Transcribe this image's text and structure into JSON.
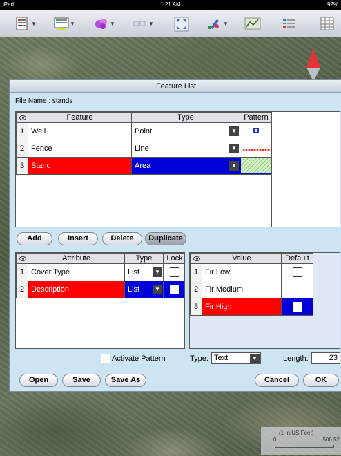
{
  "status": {
    "device": "iPad",
    "time": "1:21 AM",
    "battery": "92%"
  },
  "toolbar": {
    "buttons": [
      {
        "name": "layers-icon",
        "dropdown": true
      },
      {
        "name": "feature-icon",
        "dropdown": true
      },
      {
        "name": "shapes-icon",
        "dropdown": true
      },
      {
        "name": "gps-icon",
        "dropdown": true
      },
      {
        "name": "zoom-extent-icon",
        "dropdown": false
      },
      {
        "name": "edit-tools-icon",
        "dropdown": true
      },
      {
        "name": "measure-icon",
        "dropdown": false
      },
      {
        "name": "legend-icon",
        "dropdown": false
      },
      {
        "name": "table-icon",
        "dropdown": false
      }
    ]
  },
  "dialog": {
    "title": "Feature List",
    "file_label": "File Name : stands",
    "feature_table": {
      "headers": {
        "feature": "Feature",
        "type": "Type",
        "pattern": "Pattern"
      },
      "rows": [
        {
          "num": "1",
          "feature": "Well",
          "type": "Point",
          "pattern": "point",
          "selected": false
        },
        {
          "num": "2",
          "feature": "Fence",
          "type": "Line",
          "pattern": "line",
          "selected": false
        },
        {
          "num": "3",
          "feature": "Stand",
          "type": "Area",
          "pattern": "area",
          "selected": true
        }
      ]
    },
    "buttons": {
      "add": "Add",
      "insert": "Insert",
      "delete": "Delete",
      "duplicate": "Duplicate"
    },
    "attribute_table": {
      "headers": {
        "attribute": "Attribute",
        "type": "Type",
        "lock": "Lock"
      },
      "rows": [
        {
          "num": "1",
          "attribute": "Cover Type",
          "type": "List",
          "lock": false,
          "selected": false
        },
        {
          "num": "2",
          "attribute": "Description",
          "type": "List",
          "lock": false,
          "selected": true
        }
      ]
    },
    "value_table": {
      "headers": {
        "value": "Value",
        "default": "Default"
      },
      "rows": [
        {
          "num": "1",
          "value": "Fir Low",
          "default": false,
          "selected": false
        },
        {
          "num": "2",
          "value": "Fir Medium",
          "default": false,
          "selected": false
        },
        {
          "num": "3",
          "value": "Fir High",
          "default": false,
          "selected": true
        }
      ]
    },
    "activate_pattern": {
      "label": "Activate Pattern",
      "checked": false
    },
    "type_field": {
      "label": "Type:",
      "value": "Text"
    },
    "length_field": {
      "label": "Length:",
      "value": "23"
    },
    "footer": {
      "open": "Open",
      "save": "Save",
      "save_as": "Save As",
      "cancel": "Cancel",
      "ok": "OK"
    }
  },
  "scalebar": {
    "unit": "(1 In:US Feet)",
    "start": "0",
    "end": "506.52"
  },
  "colors": {
    "selected_red": "#ff0000",
    "selected_blue": "#0000d8",
    "dialog_bg": "#cde4f3"
  }
}
